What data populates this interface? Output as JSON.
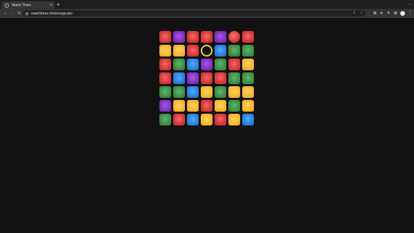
{
  "browser": {
    "tab_title": "Match Three",
    "tab_close": "×",
    "new_tab": "+",
    "tab_list": "⌄",
    "back_icon": "‹",
    "forward_icon": "›",
    "reload_icon": "↻",
    "url": "matchthree.chrisvouga.dev",
    "share_icon": "⇪",
    "star_icon": "☆",
    "menu_icon": "⋮"
  },
  "game": {
    "title": "Match Three",
    "rows": 7,
    "cols": 7,
    "colors": {
      "red": "#de3b3b",
      "purple": "#8733c7",
      "yellow": "#fbba2e",
      "blue": "#2b86e5",
      "green": "#3f9448",
      "selection": "#f2d21b"
    },
    "grid": [
      [
        "red",
        "purple",
        "red",
        "red",
        "purple",
        "red",
        "red"
      ],
      [
        "yellow",
        "yellow",
        "red",
        "empty",
        "blue",
        "green",
        "green"
      ],
      [
        "red",
        "green",
        "blue",
        "purple",
        "green",
        "red",
        "yellow"
      ],
      [
        "red",
        "blue",
        "purple",
        "red",
        "red",
        "green",
        "green"
      ],
      [
        "green",
        "green",
        "blue",
        "yellow",
        "green",
        "yellow",
        "yellow"
      ],
      [
        "purple",
        "yellow",
        "yellow",
        "red",
        "yellow",
        "green",
        "yellow"
      ],
      [
        "green",
        "red",
        "blue",
        "yellow",
        "red",
        "yellow",
        "blue"
      ]
    ],
    "selected": {
      "row": 1,
      "col": 3
    },
    "animating": {
      "row": 0,
      "col": 5,
      "shape": "ball"
    }
  }
}
